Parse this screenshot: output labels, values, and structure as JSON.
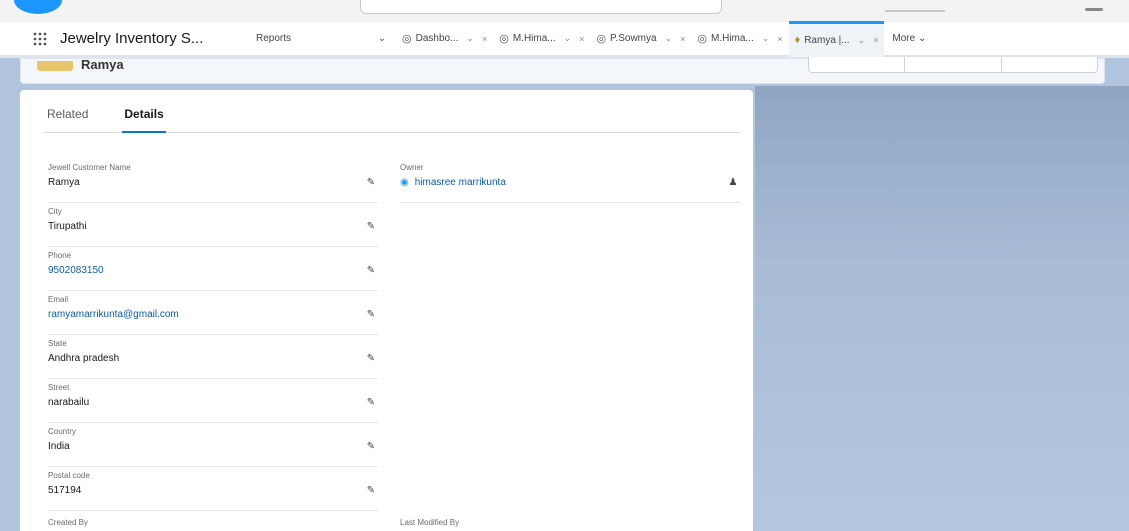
{
  "nav": {
    "app_name": "Jewelry Inventory S...",
    "reports": "Reports",
    "tabs": [
      {
        "label": "Dashbo...",
        "icon": "dashboard-icon"
      },
      {
        "label": "M.Hima...",
        "icon": "dashboard-icon"
      },
      {
        "label": "P.Sowmya",
        "icon": "dashboard-icon"
      },
      {
        "label": "M.Hima...",
        "icon": "dashboard-icon"
      },
      {
        "label": "Ramya |...",
        "icon": "record-icon"
      }
    ],
    "more": "More"
  },
  "record": {
    "title": "Ramya"
  },
  "detail_tabs": {
    "related": "Related",
    "details": "Details"
  },
  "fields": {
    "customer_name": {
      "label": "Jewell Customer Name",
      "value": "Ramya"
    },
    "city": {
      "label": "City",
      "value": "Tirupathi"
    },
    "phone": {
      "label": "Phone",
      "value": "9502083150"
    },
    "email": {
      "label": "Email",
      "value": "ramyamarrikunta@gmail.com"
    },
    "state": {
      "label": "State",
      "value": "Andhra pradesh"
    },
    "street": {
      "label": "Street",
      "value": "narabailu"
    },
    "country": {
      "label": "Country",
      "value": "India"
    },
    "postal_code": {
      "label": "Postal code",
      "value": "517194"
    },
    "owner": {
      "label": "Owner",
      "value": "himasree marrikunta"
    }
  },
  "bottom": {
    "created_by": "Created By",
    "last_modified_by": "Last Modified By"
  },
  "colors": {
    "accent": "#0176d3",
    "link": "#0b5cab",
    "background": "#b0c4de"
  }
}
